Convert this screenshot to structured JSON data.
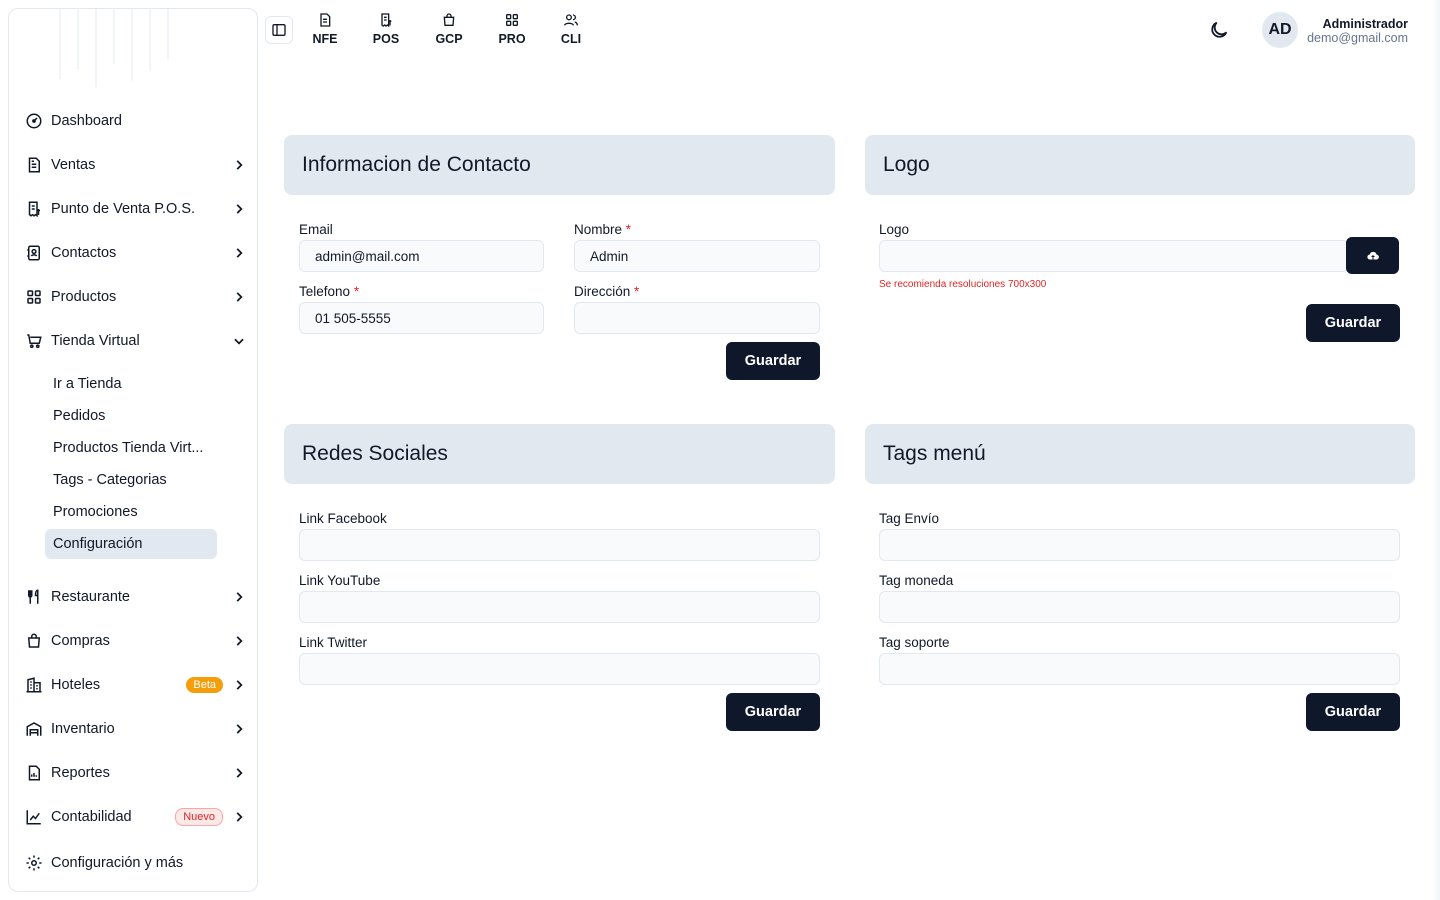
{
  "sidebar": {
    "items": [
      {
        "label": "Dashboard",
        "icon": "dashboard-gauge-icon"
      },
      {
        "label": "Ventas",
        "icon": "document-icon"
      },
      {
        "label": "Punto de Venta P.O.S.",
        "icon": "pos-receipt-icon"
      },
      {
        "label": "Contactos",
        "icon": "contacts-book-icon"
      },
      {
        "label": "Productos",
        "icon": "grid-icon"
      },
      {
        "label": "Tienda Virtual",
        "icon": "shopping-cart-icon"
      },
      {
        "label": "Restaurante",
        "icon": "utensils-icon"
      },
      {
        "label": "Compras",
        "icon": "shopping-bag-icon"
      },
      {
        "label": "Hoteles",
        "icon": "building-icon",
        "badge": "Beta"
      },
      {
        "label": "Inventario",
        "icon": "warehouse-icon"
      },
      {
        "label": "Reportes",
        "icon": "report-icon"
      },
      {
        "label": "Contabilidad",
        "icon": "chart-icon",
        "badge": "Nuevo"
      },
      {
        "label": "Configuración y más",
        "icon": "gear-icon"
      }
    ],
    "tienda_sub": [
      {
        "label": "Ir a Tienda"
      },
      {
        "label": "Pedidos"
      },
      {
        "label": "Productos Tienda Virt..."
      },
      {
        "label": "Tags - Categorias"
      },
      {
        "label": "Promociones"
      },
      {
        "label": "Configuración",
        "active": true
      }
    ]
  },
  "topbar": {
    "links": [
      {
        "label": "NFE",
        "icon": "document-icon"
      },
      {
        "label": "POS",
        "icon": "pos-receipt-icon"
      },
      {
        "label": "GCP",
        "icon": "shopping-bag-icon"
      },
      {
        "label": "PRO",
        "icon": "grid-icon"
      },
      {
        "label": "CLI",
        "icon": "users-icon"
      }
    ],
    "avatar_initials": "AD",
    "user_name": "Administrador",
    "user_email": "demo@gmail.com"
  },
  "contact": {
    "title": "Informacion de Contacto",
    "email_label": "Email",
    "email_value": "admin@mail.com",
    "nombre_label": "Nombre",
    "nombre_value": "Admin",
    "telefono_label": "Telefono",
    "telefono_value": "01 505-5555",
    "direccion_label": "Dirección",
    "direccion_value": "",
    "required_mark": "*",
    "save_label": "Guardar"
  },
  "logo": {
    "title": "Logo",
    "field_label": "Logo",
    "hint": "Se recomienda resoluciones 700x300",
    "save_label": "Guardar"
  },
  "social": {
    "title": "Redes Sociales",
    "facebook_label": "Link Facebook",
    "youtube_label": "Link YouTube",
    "twitter_label": "Link Twitter",
    "save_label": "Guardar"
  },
  "tags": {
    "title": "Tags menú",
    "envio_label": "Tag Envío",
    "moneda_label": "Tag moneda",
    "soporte_label": "Tag soporte",
    "save_label": "Guardar"
  }
}
